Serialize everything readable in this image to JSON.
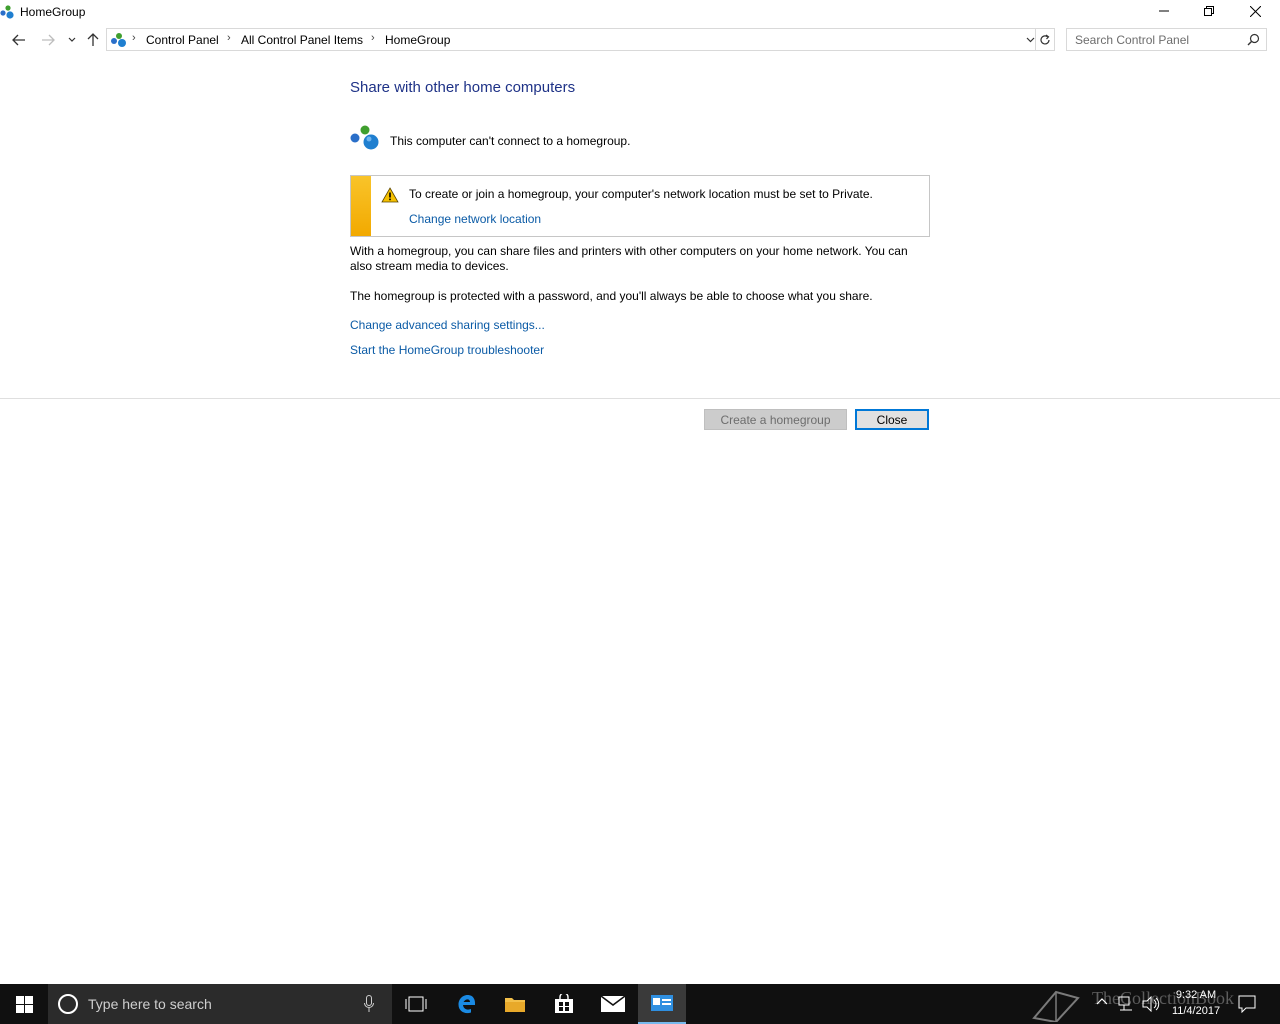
{
  "window": {
    "title": "HomeGroup",
    "icon": "homegroup-icon"
  },
  "address_bar": {
    "crumbs": [
      "Control Panel",
      "All Control Panel Items",
      "HomeGroup"
    ],
    "search_placeholder": "Search Control Panel"
  },
  "content": {
    "heading": "Share with other home computers",
    "status": "This computer can't connect to a homegroup.",
    "warning": {
      "text": "To create or join a homegroup, your computer's network location must be set to Private.",
      "link": "Change network location"
    },
    "paragraph1": "With a homegroup, you can share files and printers with other computers on your home network. You can also stream media to devices.",
    "paragraph2": "The homegroup is protected with a password, and you'll always be able to choose what you share.",
    "link_advanced": "Change advanced sharing settings...",
    "link_troubleshooter": "Start the HomeGroup troubleshooter"
  },
  "buttons": {
    "create": "Create a homegroup",
    "close": "Close"
  },
  "taskbar": {
    "search_placeholder": "Type here to search",
    "time": "9:32 AM",
    "date": "11/4/2017",
    "watermark": "TheCollectionBook"
  },
  "colors": {
    "heading": "#1e3287",
    "link": "#0b5ba6",
    "warning_strip": "#f2a900",
    "focus_border": "#0078d7",
    "taskbar": "#101010"
  }
}
